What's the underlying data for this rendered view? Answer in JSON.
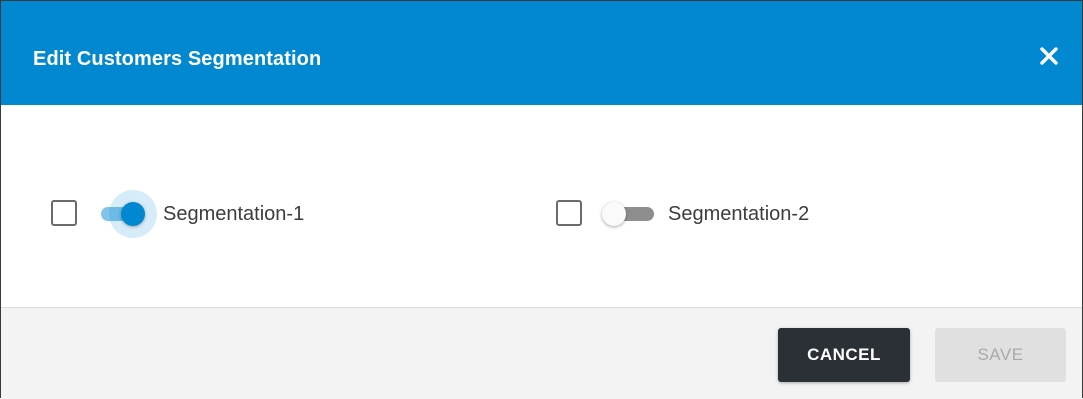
{
  "dialog": {
    "title": "Edit Customers Segmentation",
    "close_icon": "close-icon",
    "colors": {
      "header": "#0288d1",
      "header_text": "#ffffff",
      "toggle_on": "#0288d1",
      "cancel_bg": "#2b2f36",
      "save_disabled_bg": "#e0e0e0"
    }
  },
  "segments": [
    {
      "label": "Segmentation-1",
      "checked": false,
      "toggle_on": true
    },
    {
      "label": "Segmentation-2",
      "checked": false,
      "toggle_on": false
    }
  ],
  "footer": {
    "cancel_label": "CANCEL",
    "save_label": "SAVE",
    "save_disabled": true
  }
}
